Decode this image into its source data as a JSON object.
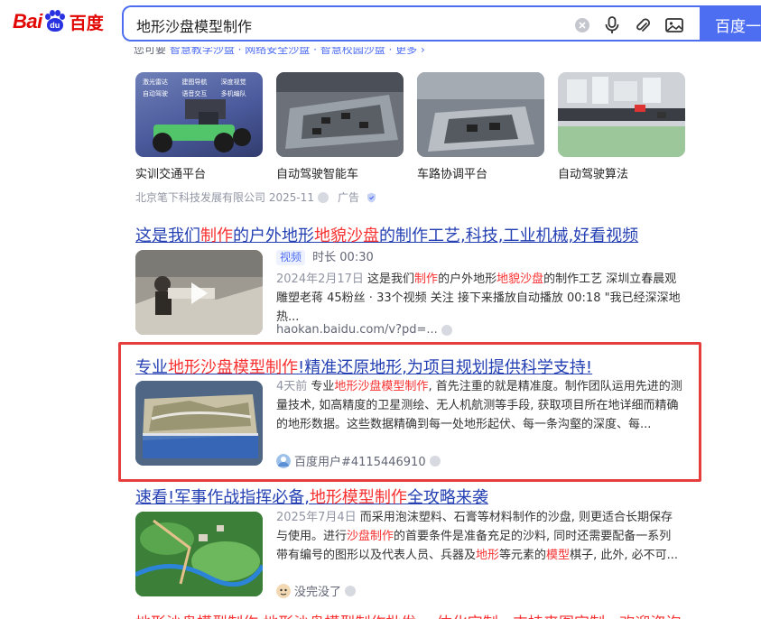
{
  "header": {
    "logo_bai": "Bai",
    "logo_du": "du",
    "logo_cn": "百度",
    "query": "地形沙盘模型制作",
    "search_button": "百度一"
  },
  "cut_line": {
    "prefix": "您可要",
    "links": "智慧教学沙盘 · 网络安全沙盘 · 智慧校园沙盘 · 更多 ›"
  },
  "ad": {
    "images": [
      {
        "label": "实训交通平台",
        "overlay": [
          "激光雷达",
          "建图导航",
          "深度视觉",
          "自动驾驶",
          "语音交互",
          "多机编队"
        ]
      },
      {
        "label": "自动驾驶智能车"
      },
      {
        "label": "车路协调平台"
      },
      {
        "label": "自动驾驶算法"
      }
    ],
    "source": "北京笔下科技发展有限公司 2025-11",
    "ad_label": "广告"
  },
  "results": [
    {
      "title_parts": [
        "这是我们",
        "制作",
        "的户外地形",
        "地貌沙盘",
        "的制作工艺,科技,工业机械,好看视频"
      ],
      "video_tag": "视频",
      "duration": "时长 00:30",
      "date": "2024年2月17日",
      "abstract_parts": [
        " 这是我们",
        "制作",
        "的户外地形",
        "地貌沙盘",
        "的制作工艺 深圳立春晨观雕塑老蒋 45粉丝 · 33个视频 关注 接下来播放自动播放 00:18 \"我已经深深地热..."
      ],
      "url": "haokan.baidu.com/v?pd=..."
    },
    {
      "title_parts": [
        "专业",
        "地形沙盘模型制作",
        "!精准还原地形,为项目规划提供科学支持!"
      ],
      "date": "4天前",
      "abstract_parts": [
        " 专业",
        "地形沙盘模型制作",
        ", 首先注重的就是精准度。制作团队运用先进的测量技术, 如高精度的卫星测绘、无人机航测等手段, 获取项目所在地详细而精确的地形数据。这些数据精确到每一处地形起伏、每一条沟壑的深度、每..."
      ],
      "author": "百度用户#4115446910"
    },
    {
      "title_parts": [
        "速看!军事作战指挥必备,",
        "地形模型制作",
        "全攻略来袭"
      ],
      "date": "2025年7月4日",
      "abstract_parts": [
        " 而采用泡沫塑料、石膏等材料制作的沙盘, 则更适合长期保存与使用。进行",
        "沙盘制作",
        "的首要条件是准备充足的沙料, 同时还需要配备一系列带有编号的图形以及代表人员、兵器及",
        "地形",
        "等元素的",
        "模型",
        "棋子, 此外, 必不可..."
      ],
      "author": "没完没了"
    }
  ],
  "bottom_cut": "地形沙盘模型制作 地形沙盘模型制作批发 一体化定制 · 支持来图定制 · 欢迎咨询"
}
